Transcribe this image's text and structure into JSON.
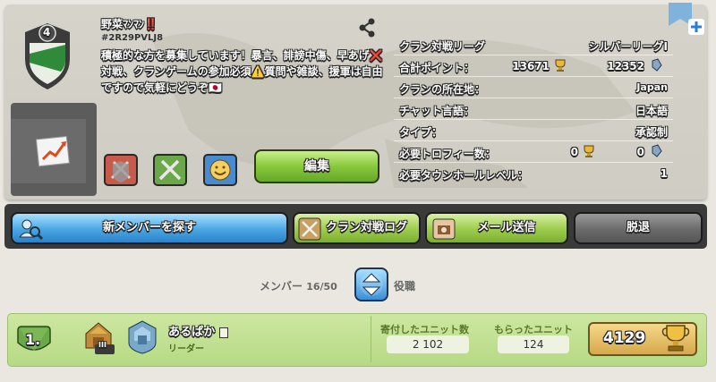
{
  "clan": {
    "level": "4",
    "name": "野菜ﾏﾝﾏﾝ‼️",
    "tag": "#2R29PVLJ8",
    "description": "積極的な方を募集しています！暴言、誹謗中傷、早あげ❌ 対戦、クランゲームの参加必須⚠️質問や雑談、援軍は自由ですので気軽にどうぞ🇯🇵"
  },
  "stats": {
    "war_league_label": "クラン対戦リーグ",
    "war_league_value": "シルバーリーグI",
    "total_points_label": "合計ポイント：",
    "total_points_trophies": "13671",
    "total_points_builder": "12352",
    "location_label": "クランの所在地：",
    "location_value": "Japan",
    "chat_language_label": "チャット言語：",
    "chat_language_value": "日本語",
    "type_label": "タイプ：",
    "type_value": "承認制",
    "required_trophies_label": "必要トロフィー数：",
    "required_trophies": "0",
    "required_builder_trophies": "0",
    "required_th_label": "必要タウンホールレベル：",
    "required_th_value": "1"
  },
  "buttons": {
    "edit": "編集",
    "find_members": "新メンバーを探す",
    "war_log": "クラン対戦ログ",
    "mail": "メール送信",
    "leave": "脱退"
  },
  "members_header": {
    "label": "メンバー",
    "count": "16/50",
    "sort_label": "役職"
  },
  "member": {
    "rank": "1.",
    "name": "あるぱか",
    "role": "リーダー",
    "th_level": "III",
    "donated_label": "寄付したユニット数",
    "donated_value": "2 102",
    "received_label": "もらったユニット",
    "received_value": "124",
    "trophies": "4129"
  },
  "colors": {
    "green_button": "#88c83a",
    "blue_button": "#4aa6e4",
    "gray_button": "#6a6a6a",
    "member_row": "#b6da83",
    "trophy_gold": "#d6a84a"
  }
}
